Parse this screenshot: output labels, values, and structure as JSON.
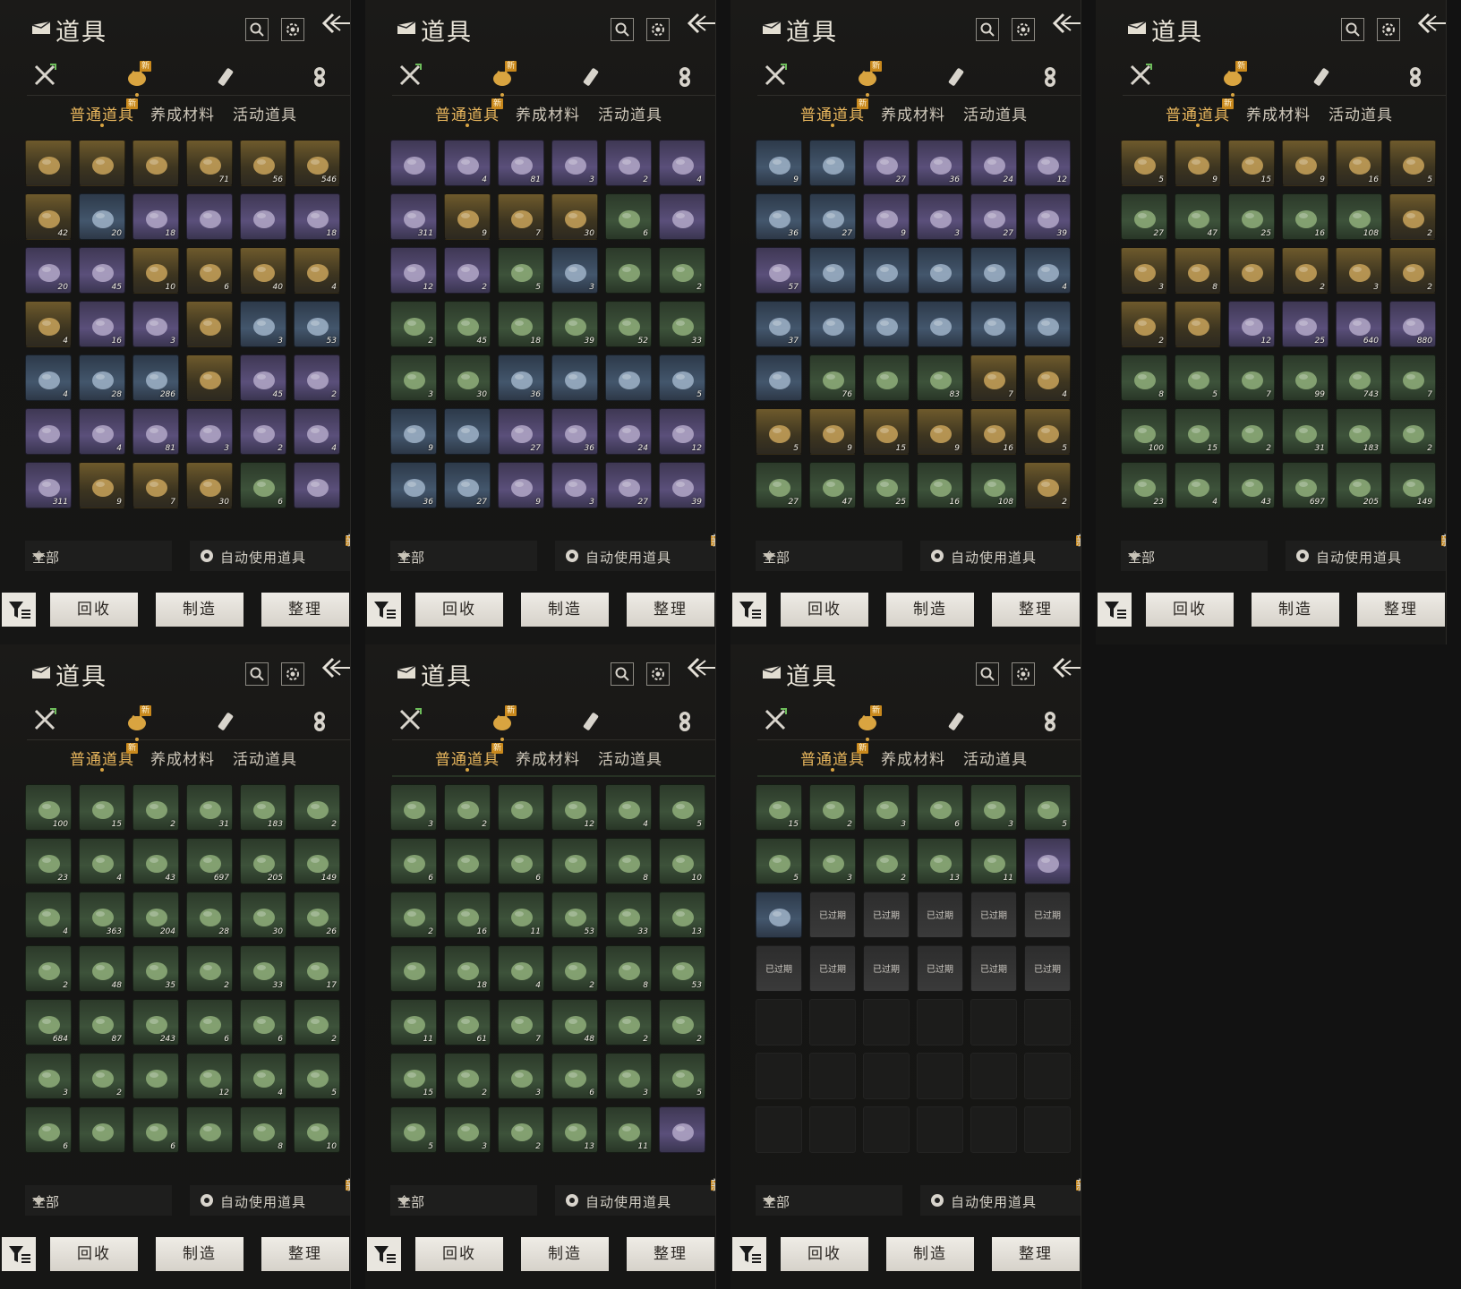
{
  "header": {
    "title": "道具"
  },
  "subtabs": [
    "普通道具",
    "养成材料",
    "活动道具"
  ],
  "new_badge": "新",
  "filter": {
    "selected": "全部"
  },
  "auto_use_label": "自动使用道具",
  "buttons": {
    "recycle": "回收",
    "craft": "制造",
    "sort": "整理"
  },
  "expired_label": "已过期",
  "colors": {
    "accent": "#e9b75d",
    "badge": "#c9891d"
  },
  "panels": [
    {
      "rows": [
        [
          "g",
          "",
          "gpu",
          "",
          "g",
          "",
          "g",
          "71",
          "g",
          "56",
          "g",
          "546"
        ],
        [
          "g",
          "42",
          "bl",
          "20",
          "pu",
          "18",
          "pu",
          "",
          "pu",
          "",
          "pu",
          "18"
        ],
        [
          "pu",
          "20",
          "pu",
          "45",
          "g",
          "10",
          "g",
          "6",
          "g",
          "40",
          "g",
          "4"
        ],
        [
          "g",
          "4",
          "pu",
          "16",
          "pu",
          "3",
          "g",
          "",
          "bl",
          "3",
          "bl",
          "53"
        ],
        [
          "bl",
          "4",
          "bl",
          "28",
          "bl",
          "286",
          "g",
          "",
          "pu",
          "45",
          "pu",
          "2"
        ],
        [
          "pu",
          "",
          "pu",
          "4",
          "pu",
          "81",
          "pu",
          "3",
          "pu",
          "2",
          "pu",
          "4"
        ],
        [
          "pu",
          "311",
          "g",
          "9",
          "g",
          "7",
          "g",
          "30",
          "gr",
          "6",
          "pu",
          ""
        ]
      ]
    },
    {
      "rows": [
        [
          "pu",
          "",
          "pu",
          "4",
          "pu",
          "81",
          "pu",
          "3",
          "pu",
          "2",
          "pu",
          "4"
        ],
        [
          "pu",
          "311",
          "g",
          "9",
          "g",
          "7",
          "g",
          "30",
          "gr",
          "6",
          "pu",
          ""
        ],
        [
          "pu",
          "12",
          "pu",
          "2",
          "gr",
          "5",
          "bl",
          "3",
          "gr",
          "",
          "gr",
          "2"
        ],
        [
          "gr",
          "2",
          "gr",
          "45",
          "gr",
          "18",
          "gr",
          "39",
          "gr",
          "52",
          "gr",
          "33"
        ],
        [
          "gr",
          "3",
          "gr",
          "30",
          "bl",
          "36",
          "bl",
          "",
          "bl",
          "",
          "bl",
          "5"
        ],
        [
          "bl",
          "9",
          "bl",
          "",
          "pu",
          "27",
          "pu",
          "36",
          "pu",
          "24",
          "pu",
          "12"
        ],
        [
          "bl",
          "36",
          "bl",
          "27",
          "pu",
          "9",
          "pu",
          "3",
          "pu",
          "27",
          "pu",
          "39"
        ]
      ]
    },
    {
      "rows": [
        [
          "bl",
          "9",
          "bl",
          "",
          "pu",
          "27",
          "pu",
          "36",
          "pu",
          "24",
          "pu",
          "12"
        ],
        [
          "bl",
          "36",
          "bl",
          "27",
          "pu",
          "9",
          "pu",
          "3",
          "pu",
          "27",
          "pu",
          "39"
        ],
        [
          "pu",
          "57",
          "bl",
          "",
          "bl",
          "",
          "bl",
          "",
          "bl",
          "",
          "bl",
          "4"
        ],
        [
          "bl",
          "37",
          "bl",
          "",
          "bl",
          "",
          "bl",
          "",
          "bl",
          "",
          "bl",
          ""
        ],
        [
          "bl",
          "",
          "gr",
          "76",
          "gr",
          "",
          "gr",
          "83",
          "g",
          "7",
          "g",
          "4"
        ],
        [
          "g",
          "5",
          "g",
          "9",
          "g",
          "15",
          "g",
          "9",
          "g",
          "16",
          "g",
          "5"
        ],
        [
          "gr",
          "27",
          "gr",
          "47",
          "gr",
          "25",
          "gr",
          "16",
          "gr",
          "108",
          "g",
          "2"
        ]
      ]
    },
    {
      "rows": [
        [
          "g",
          "5",
          "g",
          "9",
          "g",
          "15",
          "g",
          "9",
          "g",
          "16",
          "g",
          "5"
        ],
        [
          "gr",
          "27",
          "gr",
          "47",
          "gr",
          "25",
          "gr",
          "16",
          "gr",
          "108",
          "g",
          "2"
        ],
        [
          "g",
          "3",
          "g",
          "8",
          "g",
          "",
          "g",
          "2",
          "g",
          "3",
          "g",
          "2"
        ],
        [
          "g",
          "2",
          "g",
          "",
          "pu",
          "12",
          "pu",
          "25",
          "pu",
          "640",
          "pu",
          "880"
        ],
        [
          "gr",
          "8",
          "gr",
          "5",
          "gr",
          "7",
          "gr",
          "99",
          "gr",
          "743",
          "gr",
          "7"
        ],
        [
          "gr",
          "100",
          "gr",
          "15",
          "gr",
          "2",
          "gr",
          "31",
          "gr",
          "183",
          "gr",
          "2"
        ],
        [
          "gr",
          "23",
          "gr",
          "4",
          "gr",
          "43",
          "gr",
          "697",
          "gr",
          "205",
          "gr",
          "149"
        ]
      ]
    },
    {
      "rows": [
        [
          "gr",
          "100",
          "gr",
          "15",
          "gr",
          "2",
          "gr",
          "31",
          "gr",
          "183",
          "gr",
          "2"
        ],
        [
          "gr",
          "23",
          "gr",
          "4",
          "gr",
          "43",
          "gr",
          "697",
          "gr",
          "205",
          "gr",
          "149"
        ],
        [
          "gr",
          "4",
          "gr",
          "363",
          "gr",
          "204",
          "gr",
          "28",
          "gr",
          "30",
          "gr",
          "26"
        ],
        [
          "gr",
          "2",
          "gr",
          "48",
          "gr",
          "35",
          "gr",
          "2",
          "gr",
          "33",
          "gr",
          "17"
        ],
        [
          "gr",
          "684",
          "gr",
          "87",
          "gr",
          "243",
          "gr",
          "6",
          "gr",
          "6",
          "gr",
          "2"
        ],
        [
          "gr",
          "3",
          "gr",
          "2",
          "gr",
          "",
          "gr",
          "12",
          "gr",
          "4",
          "gr",
          "5"
        ],
        [
          "gr",
          "6",
          "gr",
          "",
          "gr",
          "6",
          "gr",
          "",
          "gr",
          "8",
          "gr",
          "10"
        ]
      ]
    },
    {
      "rows": [
        [
          "gr",
          "3",
          "gr",
          "2",
          "gr",
          "",
          "gr",
          "12",
          "gr",
          "4",
          "gr",
          "5"
        ],
        [
          "gr",
          "6",
          "gr",
          "",
          "gr",
          "6",
          "gr",
          "",
          "gr",
          "8",
          "gr",
          "10"
        ],
        [
          "gr",
          "2",
          "gr",
          "16",
          "gr",
          "11",
          "gr",
          "53",
          "gr",
          "33",
          "gr",
          "13"
        ],
        [
          "gr",
          "",
          "gr",
          "18",
          "gr",
          "4",
          "gr",
          "2",
          "gr",
          "8",
          "gr",
          "53"
        ],
        [
          "gr",
          "11",
          "gr",
          "61",
          "gr",
          "7",
          "gr",
          "48",
          "gr",
          "2",
          "gr",
          "2"
        ],
        [
          "gr",
          "15",
          "gr",
          "2",
          "gr",
          "3",
          "gr",
          "6",
          "gr",
          "3",
          "gr",
          "5"
        ],
        [
          "gr",
          "5",
          "gr",
          "3",
          "gr",
          "2",
          "gr",
          "13",
          "gr",
          "11",
          "pu",
          ""
        ]
      ]
    },
    {
      "rows": [
        [
          "gr",
          "15",
          "gr",
          "2",
          "gr",
          "3",
          "gr",
          "6",
          "gr",
          "3",
          "gr",
          "5"
        ],
        [
          "gr",
          "5",
          "gr",
          "3",
          "gr",
          "2",
          "gr",
          "13",
          "gr",
          "11",
          "pu",
          ""
        ],
        [
          "bl",
          "",
          "ex",
          "",
          "ex",
          "",
          "ex",
          "",
          "ex",
          "",
          "ex",
          ""
        ],
        [
          "ex",
          "",
          "ex",
          "",
          "ex",
          "",
          "ex",
          "",
          "ex",
          "",
          "ex",
          ""
        ],
        [
          "em",
          "",
          "em",
          "",
          "em",
          "",
          "em",
          "",
          "em",
          "",
          "em",
          ""
        ],
        [
          "em",
          "",
          "em",
          "",
          "em",
          "",
          "em",
          "",
          "em",
          "",
          "em",
          ""
        ],
        [
          "em",
          "",
          "em",
          "",
          "em",
          "",
          "em",
          "",
          "em",
          "",
          "em",
          ""
        ]
      ]
    }
  ]
}
